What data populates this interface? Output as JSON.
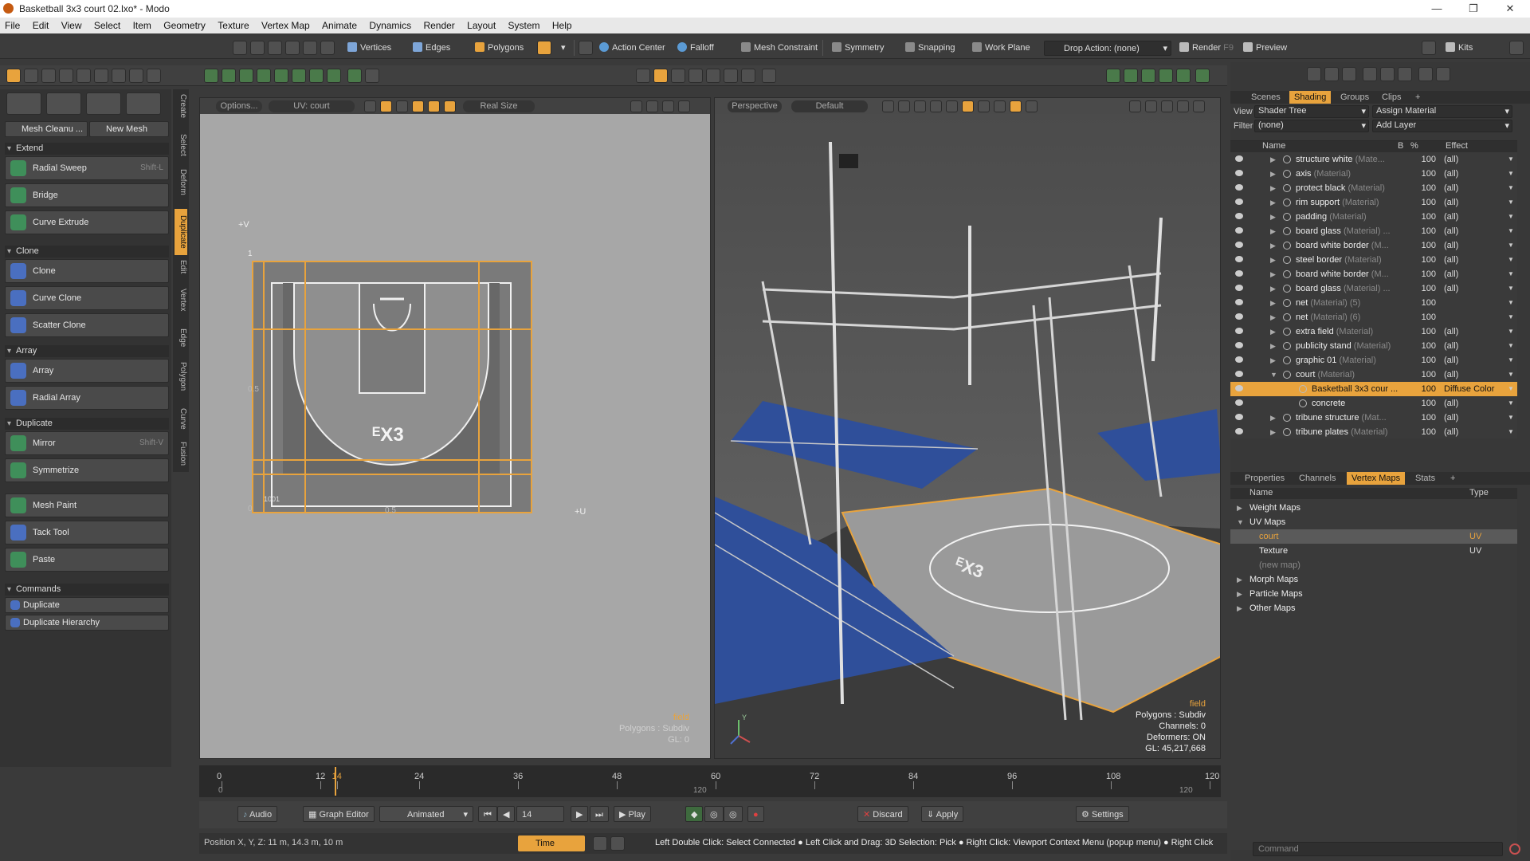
{
  "window": {
    "title": "Basketball 3x3 court 02.lxo* - Modo",
    "min": "—",
    "max": "❐",
    "close": "✕"
  },
  "menu": [
    "File",
    "Edit",
    "View",
    "Select",
    "Item",
    "Geometry",
    "Texture",
    "Vertex Map",
    "Animate",
    "Dynamics",
    "Render",
    "Layout",
    "System",
    "Help"
  ],
  "toolbar": {
    "vertices": "Vertices",
    "edges": "Edges",
    "polygons": "Polygons",
    "action_center": "Action Center",
    "falloff": "Falloff",
    "mesh_constraint": "Mesh Constraint",
    "symmetry": "Symmetry",
    "snapping": "Snapping",
    "work_plane": "Work Plane",
    "drop_action": "Drop Action: (none)",
    "render": "Render",
    "render_key": "F9",
    "preview": "Preview",
    "kits": "Kits"
  },
  "left_panel": {
    "mesh_cleanup": "Mesh Cleanu ...",
    "new_mesh": "New Mesh",
    "sections": [
      {
        "title": "Extend",
        "items": [
          {
            "label": "Radial Sweep",
            "shortcut": "Shift-L"
          },
          {
            "label": "Bridge"
          },
          {
            "label": "Curve Extrude"
          }
        ]
      },
      {
        "title": "Clone",
        "items": [
          {
            "label": "Clone"
          },
          {
            "label": "Curve Clone"
          },
          {
            "label": "Scatter Clone"
          }
        ]
      },
      {
        "title": "Array",
        "items": [
          {
            "label": "Array"
          },
          {
            "label": "Radial Array"
          }
        ]
      },
      {
        "title": "Duplicate",
        "items": [
          {
            "label": "Mirror",
            "shortcut": "Shift-V"
          },
          {
            "label": "Symmetrize"
          }
        ]
      },
      {
        "title": "",
        "items": [
          {
            "label": "Mesh Paint"
          },
          {
            "label": "Tack Tool"
          },
          {
            "label": "Paste"
          }
        ]
      },
      {
        "title": "Commands",
        "items": [
          {
            "label": "Duplicate"
          },
          {
            "label": "Duplicate Hierarchy"
          }
        ]
      }
    ],
    "side_tabs": [
      "Create",
      "Select",
      "Deform",
      "Duplicate",
      "Edit",
      "Vertex",
      "Edge",
      "Polygon",
      "Curve",
      "Fusion"
    ]
  },
  "uv_view": {
    "options": "Options...",
    "uv_map": "UV: court",
    "real_size": "Real Size",
    "plus_v": "+V",
    "plus_u": "+U",
    "one": "1",
    "half_v": "0.5",
    "half_u": "0.5",
    "zero": "0",
    "tile": "1001",
    "logo": "ᴱX3",
    "info_item": "field",
    "info_poly": "Polygons : Subdiv",
    "info_gl": "GL: 0"
  },
  "persp_view": {
    "camera": "Perspective",
    "style": "Default",
    "info_item": "field",
    "info_poly": "Polygons : Subdiv",
    "info_channels": "Channels: 0",
    "info_deformers": "Deformers: ON",
    "info_gl": "GL: 45,217,668",
    "axis": "Y"
  },
  "shading": {
    "tabs": [
      "Scenes",
      "Shading",
      "Groups",
      "Clips"
    ],
    "view_label": "View",
    "view_value": "Shader Tree",
    "assign": "Assign Material",
    "filter_label": "Filter",
    "filter_value": "(none)",
    "add_layer": "Add Layer",
    "col_name": "Name",
    "col_b": "B",
    "col_pct": "%",
    "col_effect": "Effect",
    "rows": [
      {
        "name": "structure white",
        "type": "(Mate...",
        "pct": "100",
        "effect": "(all)"
      },
      {
        "name": "axis",
        "type": "(Material)",
        "pct": "100",
        "effect": "(all)"
      },
      {
        "name": "protect black",
        "type": "(Material)",
        "pct": "100",
        "effect": "(all)"
      },
      {
        "name": "rim support",
        "type": "(Material)",
        "pct": "100",
        "effect": "(all)"
      },
      {
        "name": "padding",
        "type": "(Material)",
        "pct": "100",
        "effect": "(all)"
      },
      {
        "name": "board glass",
        "type": "(Material) ...",
        "pct": "100",
        "effect": "(all)"
      },
      {
        "name": "board white border",
        "type": "(M...",
        "pct": "100",
        "effect": "(all)"
      },
      {
        "name": "steel border",
        "type": "(Material)",
        "pct": "100",
        "effect": "(all)"
      },
      {
        "name": "board white border",
        "type": "(M...",
        "pct": "100",
        "effect": "(all)"
      },
      {
        "name": "board glass",
        "type": "(Material) ...",
        "pct": "100",
        "effect": "(all)"
      },
      {
        "name": "net",
        "type": "(Material) (5)",
        "pct": "100",
        "effect": ""
      },
      {
        "name": "net",
        "type": "(Material) (6)",
        "pct": "100",
        "effect": ""
      },
      {
        "name": "extra field",
        "type": "(Material)",
        "pct": "100",
        "effect": "(all)"
      },
      {
        "name": "publicity stand",
        "type": "(Material)",
        "pct": "100",
        "effect": "(all)"
      },
      {
        "name": "graphic 01",
        "type": "(Material)",
        "pct": "100",
        "effect": "(all)"
      },
      {
        "name": "court",
        "type": "(Material)",
        "pct": "100",
        "effect": "(all)"
      },
      {
        "name": "Basketball 3x3 cour ...",
        "type": "",
        "pct": "100",
        "effect": "Diffuse Color"
      },
      {
        "name": "concrete",
        "type": "",
        "pct": "100",
        "effect": "(all)"
      },
      {
        "name": "tribune structure",
        "type": "(Mat...",
        "pct": "100",
        "effect": "(all)"
      },
      {
        "name": "tribune plates",
        "type": "(Material)",
        "pct": "100",
        "effect": "(all)"
      }
    ]
  },
  "vmaps": {
    "tabs": [
      "Properties",
      "Channels",
      "Vertex Maps",
      "Stats"
    ],
    "col_name": "Name",
    "col_type": "Type",
    "rows": [
      {
        "name": "Weight Maps",
        "type": ""
      },
      {
        "name": "UV Maps",
        "type": ""
      },
      {
        "name": "court",
        "type": "UV"
      },
      {
        "name": "Texture",
        "type": "UV"
      },
      {
        "name": "(new map)",
        "type": ""
      },
      {
        "name": "Morph Maps",
        "type": ""
      },
      {
        "name": "Particle Maps",
        "type": ""
      },
      {
        "name": "Other Maps",
        "type": ""
      }
    ]
  },
  "timeline": {
    "ticks": [
      "0",
      "12",
      "14",
      "24",
      "36",
      "48",
      "60",
      "72",
      "84",
      "96",
      "108",
      "120"
    ],
    "sub": [
      "0",
      "120",
      "120"
    ]
  },
  "transport": {
    "audio": "Audio",
    "graph_editor": "Graph Editor",
    "mode": "Animated",
    "frame": "14",
    "play": "Play",
    "discard": "Discard",
    "apply": "Apply",
    "settings": "Settings"
  },
  "status": {
    "position": "Position X, Y, Z:   11 m, 14.3 m, 10 m",
    "time": "Time",
    "hint": "Left Double Click: Select Connected ● Left Click and Drag: 3D Selection: Pick ● Right Click: Viewport Context Menu (popup menu) ● Right Click",
    "command_placeholder": "Command"
  }
}
